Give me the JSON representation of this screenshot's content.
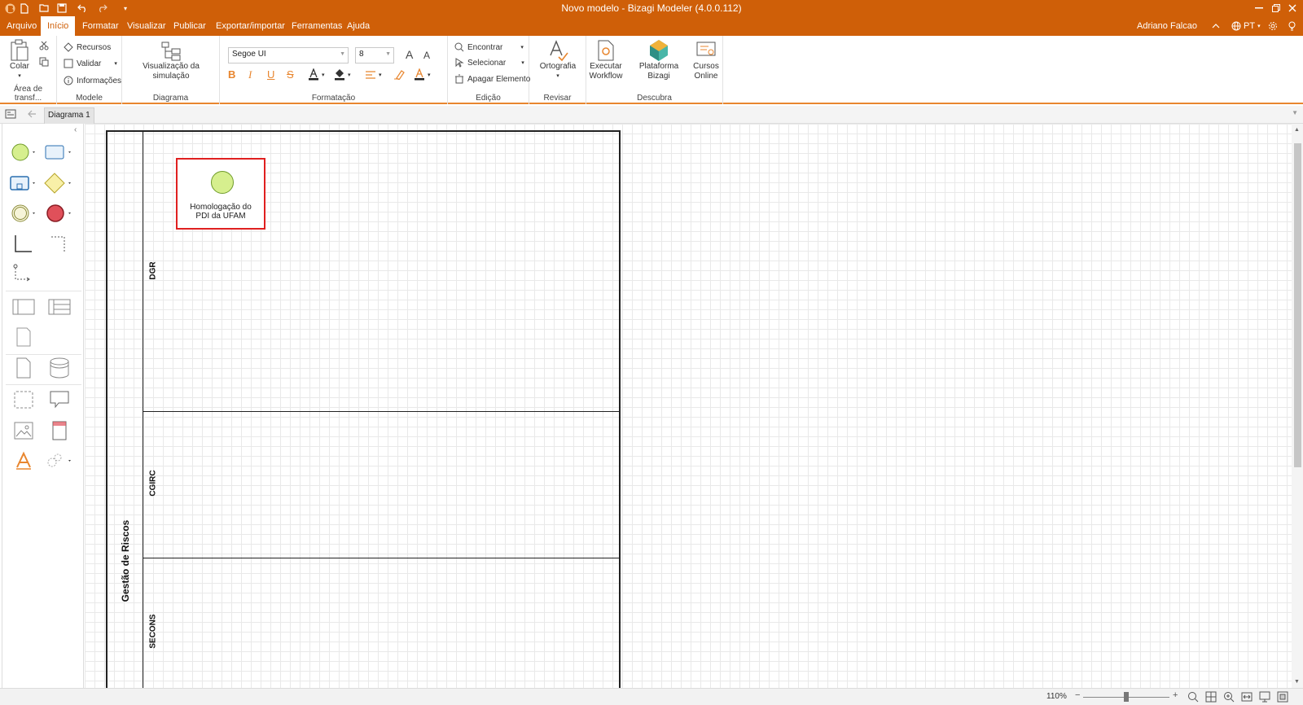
{
  "window": {
    "title": "Novo modelo - Bizagi Modeler (4.0.0.112)"
  },
  "menu": {
    "items": [
      "Arquivo",
      "Início",
      "Formatar",
      "Visualizar",
      "Publicar",
      "Exportar/importar",
      "Ferramentas",
      "Ajuda"
    ],
    "active": "Início",
    "user": "Adriano Falcao",
    "language": "PT"
  },
  "ribbon": {
    "clipboard": {
      "paste_label": "Colar",
      "group_label": "Área de transf..."
    },
    "model": {
      "resources": "Recursos",
      "validate": "Validar",
      "info": "Informações",
      "group_label": "Modele"
    },
    "diagram": {
      "simulation": "Visualização da simulação",
      "group_label": "Diagrama"
    },
    "formatting": {
      "font": "Segoe UI",
      "size": "8",
      "group_label": "Formatação"
    },
    "editing": {
      "find": "Encontrar",
      "select": "Selecionar",
      "delete": "Apagar Elemento",
      "group_label": "Edição"
    },
    "review": {
      "spelling": "Ortografia",
      "group_label": "Revisar"
    },
    "discover": {
      "run_workflow_1": "Executar",
      "run_workflow_2": "Workflow",
      "platform": "Plataforma Bizagi",
      "courses_1": "Cursos",
      "courses_2": "Online",
      "group_label": "Descubra"
    }
  },
  "tabs": {
    "document": "Diagrama 1"
  },
  "diagram": {
    "pool_name": "Gestão de Riscos",
    "lanes": [
      "DGR",
      "CGIRC",
      "SECONS"
    ],
    "start_event_label_1": "Homologação do",
    "start_event_label_2": "PDI da UFAM"
  },
  "status": {
    "zoom": "110%"
  },
  "colors": {
    "accent": "#cf5f08",
    "start_event": "#d6ef8e",
    "end_event": "#e0505a",
    "selection": "#e02020"
  }
}
